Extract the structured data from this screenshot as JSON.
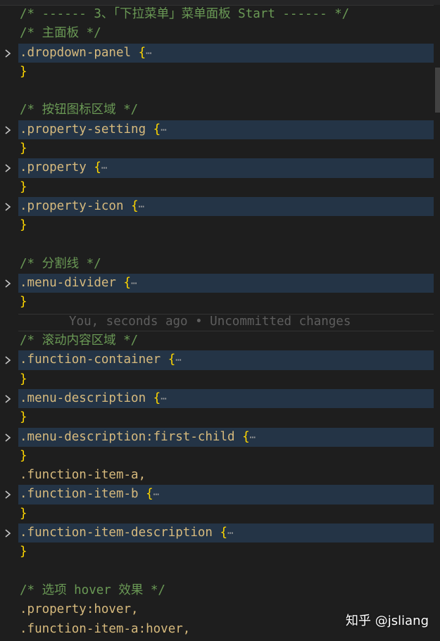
{
  "lines": [
    {
      "type": "comment",
      "text": "/* ------ 3、「下拉菜单」菜单面板 Start ------ */"
    },
    {
      "type": "comment",
      "text": "/* 主面板 */"
    },
    {
      "type": "fold",
      "selector": ".dropdown-panel",
      "brace": "{",
      "ellipsis": "⋯"
    },
    {
      "type": "close",
      "brace": "}"
    },
    {
      "type": "blank"
    },
    {
      "type": "comment",
      "text": "/* 按钮图标区域 */"
    },
    {
      "type": "fold",
      "selector": ".property-setting",
      "brace": "{",
      "ellipsis": "⋯"
    },
    {
      "type": "close",
      "brace": "}"
    },
    {
      "type": "fold",
      "selector": ".property",
      "brace": "{",
      "ellipsis": "⋯"
    },
    {
      "type": "close",
      "brace": "}"
    },
    {
      "type": "fold",
      "selector": ".property-icon",
      "brace": "{",
      "ellipsis": "⋯"
    },
    {
      "type": "close",
      "brace": "}"
    },
    {
      "type": "blank"
    },
    {
      "type": "comment",
      "text": "/* 分割线 */"
    },
    {
      "type": "fold",
      "selector": ".menu-divider",
      "brace": "{",
      "ellipsis": "⋯"
    },
    {
      "type": "close",
      "brace": "}"
    },
    {
      "type": "blame",
      "text": "You, seconds ago • Uncommitted changes"
    },
    {
      "type": "comment",
      "text": "/* 滚动内容区域 */"
    },
    {
      "type": "fold",
      "selector": ".function-container",
      "brace": "{",
      "ellipsis": "⋯"
    },
    {
      "type": "close",
      "brace": "}"
    },
    {
      "type": "fold",
      "selector": ".menu-description",
      "brace": "{",
      "ellipsis": "⋯"
    },
    {
      "type": "close",
      "brace": "}"
    },
    {
      "type": "fold",
      "selector": ".menu-description:first-child",
      "brace": "{",
      "ellipsis": "⋯"
    },
    {
      "type": "close",
      "brace": "}"
    },
    {
      "type": "plain",
      "selector": ".function-item-a,"
    },
    {
      "type": "fold",
      "selector": ".function-item-b",
      "brace": "{",
      "ellipsis": "⋯"
    },
    {
      "type": "close",
      "brace": "}"
    },
    {
      "type": "fold",
      "selector": ".function-item-description",
      "brace": "{",
      "ellipsis": "⋯"
    },
    {
      "type": "close",
      "brace": "}"
    },
    {
      "type": "blank"
    },
    {
      "type": "comment",
      "text": "/* 选项 hover 效果 */"
    },
    {
      "type": "plain",
      "selector": ".property:hover,"
    },
    {
      "type": "plain",
      "selector": ".function-item-a:hover,"
    }
  ],
  "watermark": "知乎 @jsliang",
  "colors": {
    "background": "#1e1e1e",
    "comment": "#6a9955",
    "selector": "#d7ba7d",
    "brace": "#ffd700",
    "fold_highlight": "#243446"
  },
  "icons": {
    "fold": "chevron-right-icon"
  }
}
